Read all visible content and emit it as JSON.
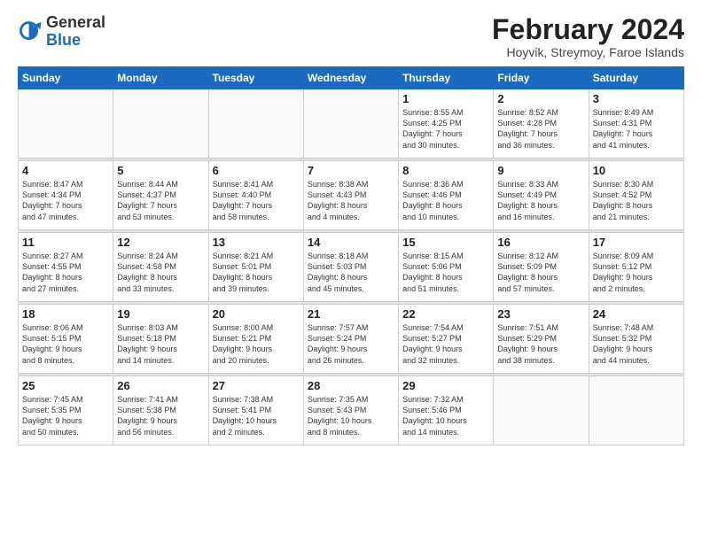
{
  "header": {
    "logo_general": "General",
    "logo_blue": "Blue",
    "month_title": "February 2024",
    "location": "Hoyvik, Streymoy, Faroe Islands"
  },
  "days_of_week": [
    "Sunday",
    "Monday",
    "Tuesday",
    "Wednesday",
    "Thursday",
    "Friday",
    "Saturday"
  ],
  "weeks": [
    [
      {
        "day": "",
        "info": ""
      },
      {
        "day": "",
        "info": ""
      },
      {
        "day": "",
        "info": ""
      },
      {
        "day": "",
        "info": ""
      },
      {
        "day": "1",
        "info": "Sunrise: 8:55 AM\nSunset: 4:25 PM\nDaylight: 7 hours\nand 30 minutes."
      },
      {
        "day": "2",
        "info": "Sunrise: 8:52 AM\nSunset: 4:28 PM\nDaylight: 7 hours\nand 36 minutes."
      },
      {
        "day": "3",
        "info": "Sunrise: 8:49 AM\nSunset: 4:31 PM\nDaylight: 7 hours\nand 41 minutes."
      }
    ],
    [
      {
        "day": "4",
        "info": "Sunrise: 8:47 AM\nSunset: 4:34 PM\nDaylight: 7 hours\nand 47 minutes."
      },
      {
        "day": "5",
        "info": "Sunrise: 8:44 AM\nSunset: 4:37 PM\nDaylight: 7 hours\nand 53 minutes."
      },
      {
        "day": "6",
        "info": "Sunrise: 8:41 AM\nSunset: 4:40 PM\nDaylight: 7 hours\nand 58 minutes."
      },
      {
        "day": "7",
        "info": "Sunrise: 8:38 AM\nSunset: 4:43 PM\nDaylight: 8 hours\nand 4 minutes."
      },
      {
        "day": "8",
        "info": "Sunrise: 8:36 AM\nSunset: 4:46 PM\nDaylight: 8 hours\nand 10 minutes."
      },
      {
        "day": "9",
        "info": "Sunrise: 8:33 AM\nSunset: 4:49 PM\nDaylight: 8 hours\nand 16 minutes."
      },
      {
        "day": "10",
        "info": "Sunrise: 8:30 AM\nSunset: 4:52 PM\nDaylight: 8 hours\nand 21 minutes."
      }
    ],
    [
      {
        "day": "11",
        "info": "Sunrise: 8:27 AM\nSunset: 4:55 PM\nDaylight: 8 hours\nand 27 minutes."
      },
      {
        "day": "12",
        "info": "Sunrise: 8:24 AM\nSunset: 4:58 PM\nDaylight: 8 hours\nand 33 minutes."
      },
      {
        "day": "13",
        "info": "Sunrise: 8:21 AM\nSunset: 5:01 PM\nDaylight: 8 hours\nand 39 minutes."
      },
      {
        "day": "14",
        "info": "Sunrise: 8:18 AM\nSunset: 5:03 PM\nDaylight: 8 hours\nand 45 minutes."
      },
      {
        "day": "15",
        "info": "Sunrise: 8:15 AM\nSunset: 5:06 PM\nDaylight: 8 hours\nand 51 minutes."
      },
      {
        "day": "16",
        "info": "Sunrise: 8:12 AM\nSunset: 5:09 PM\nDaylight: 8 hours\nand 57 minutes."
      },
      {
        "day": "17",
        "info": "Sunrise: 8:09 AM\nSunset: 5:12 PM\nDaylight: 9 hours\nand 2 minutes."
      }
    ],
    [
      {
        "day": "18",
        "info": "Sunrise: 8:06 AM\nSunset: 5:15 PM\nDaylight: 9 hours\nand 8 minutes."
      },
      {
        "day": "19",
        "info": "Sunrise: 8:03 AM\nSunset: 5:18 PM\nDaylight: 9 hours\nand 14 minutes."
      },
      {
        "day": "20",
        "info": "Sunrise: 8:00 AM\nSunset: 5:21 PM\nDaylight: 9 hours\nand 20 minutes."
      },
      {
        "day": "21",
        "info": "Sunrise: 7:57 AM\nSunset: 5:24 PM\nDaylight: 9 hours\nand 26 minutes."
      },
      {
        "day": "22",
        "info": "Sunrise: 7:54 AM\nSunset: 5:27 PM\nDaylight: 9 hours\nand 32 minutes."
      },
      {
        "day": "23",
        "info": "Sunrise: 7:51 AM\nSunset: 5:29 PM\nDaylight: 9 hours\nand 38 minutes."
      },
      {
        "day": "24",
        "info": "Sunrise: 7:48 AM\nSunset: 5:32 PM\nDaylight: 9 hours\nand 44 minutes."
      }
    ],
    [
      {
        "day": "25",
        "info": "Sunrise: 7:45 AM\nSunset: 5:35 PM\nDaylight: 9 hours\nand 50 minutes."
      },
      {
        "day": "26",
        "info": "Sunrise: 7:41 AM\nSunset: 5:38 PM\nDaylight: 9 hours\nand 56 minutes."
      },
      {
        "day": "27",
        "info": "Sunrise: 7:38 AM\nSunset: 5:41 PM\nDaylight: 10 hours\nand 2 minutes."
      },
      {
        "day": "28",
        "info": "Sunrise: 7:35 AM\nSunset: 5:43 PM\nDaylight: 10 hours\nand 8 minutes."
      },
      {
        "day": "29",
        "info": "Sunrise: 7:32 AM\nSunset: 5:46 PM\nDaylight: 10 hours\nand 14 minutes."
      },
      {
        "day": "",
        "info": ""
      },
      {
        "day": "",
        "info": ""
      }
    ]
  ]
}
